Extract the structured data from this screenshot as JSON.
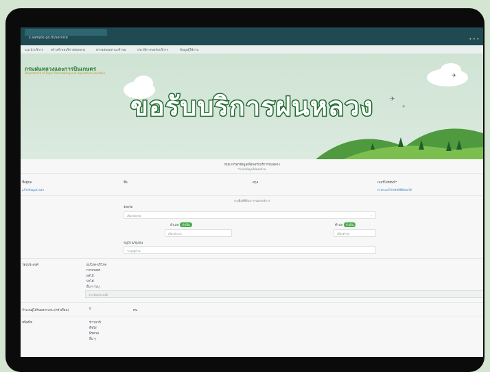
{
  "browser": {
    "tab_label": "x.sample.go.th/service",
    "window_controls": "• • •"
  },
  "bookmarks": [
    "แนะนำบริการ",
    "สร้างคำขอบริการฝนหลวง",
    "ตรวจสอบสถานะคำขอ",
    "ประวัติการขอรับบริการ",
    "ข้อมูลผู้ใช้งาน"
  ],
  "hero": {
    "brand": "กรมฝนหลวงและการบินเกษตร",
    "brand_sub": "Department of Royal Rainmaking and Agricultural Aviation",
    "title": "ขอรับบริการฝนหลวง"
  },
  "form": {
    "intro_line1": "กรุณากรอกข้อมูลเพื่อขอรับบริการฝนหลวง",
    "intro_line2": "*กรอกข้อมูลให้ครบถ้วน",
    "row1_labels": [
      "ชื่อผู้ขอ",
      "ชื่อ",
      "สกุล",
      "เบอร์โทรศัพท์*"
    ],
    "row1_links": [
      "แก้ไขข้อมูลส่วนตัว",
      "กรอกเบอร์โทรศัพท์ที่ติดต่อได้"
    ],
    "location_note": "ระบุพื้นที่ที่ต้องการขอรับบริการ",
    "province_label": "จังหวัด",
    "province_placeholder": "เลือกจังหวัด",
    "district_label": "อำเภอ",
    "district_badge": "จำเป็น",
    "district_placeholder": "เลือกอำเภอ",
    "subdistrict_label": "ตำบล",
    "subdistrict_badge": "จำเป็น",
    "subdistrict_placeholder": "เลือกตำบล",
    "village_label": "หมู่บ้าน/ชุมชน",
    "village_placeholder": "ระบุหมู่บ้าน",
    "purpose_label": "วัตถุประสงค์",
    "purpose_options": [
      "อุปโภค-บริโภค",
      "การเกษตร",
      "ผลไม้",
      "ป่าไม้",
      "อื่น ๆ ระบุ"
    ],
    "purpose_other": "ระบุวัตถุประสงค์",
    "affected_label": "จำนวนผู้ได้รับผลกระทบ (ครัวเรือน)",
    "affected_value": "0",
    "affected_unit": "คน",
    "crop_label": "ชนิดพืช",
    "crop_options": [
      "ข้าวนาปี",
      "พืชไร่",
      "พืชสวน",
      "อื่น ๆ"
    ]
  }
}
